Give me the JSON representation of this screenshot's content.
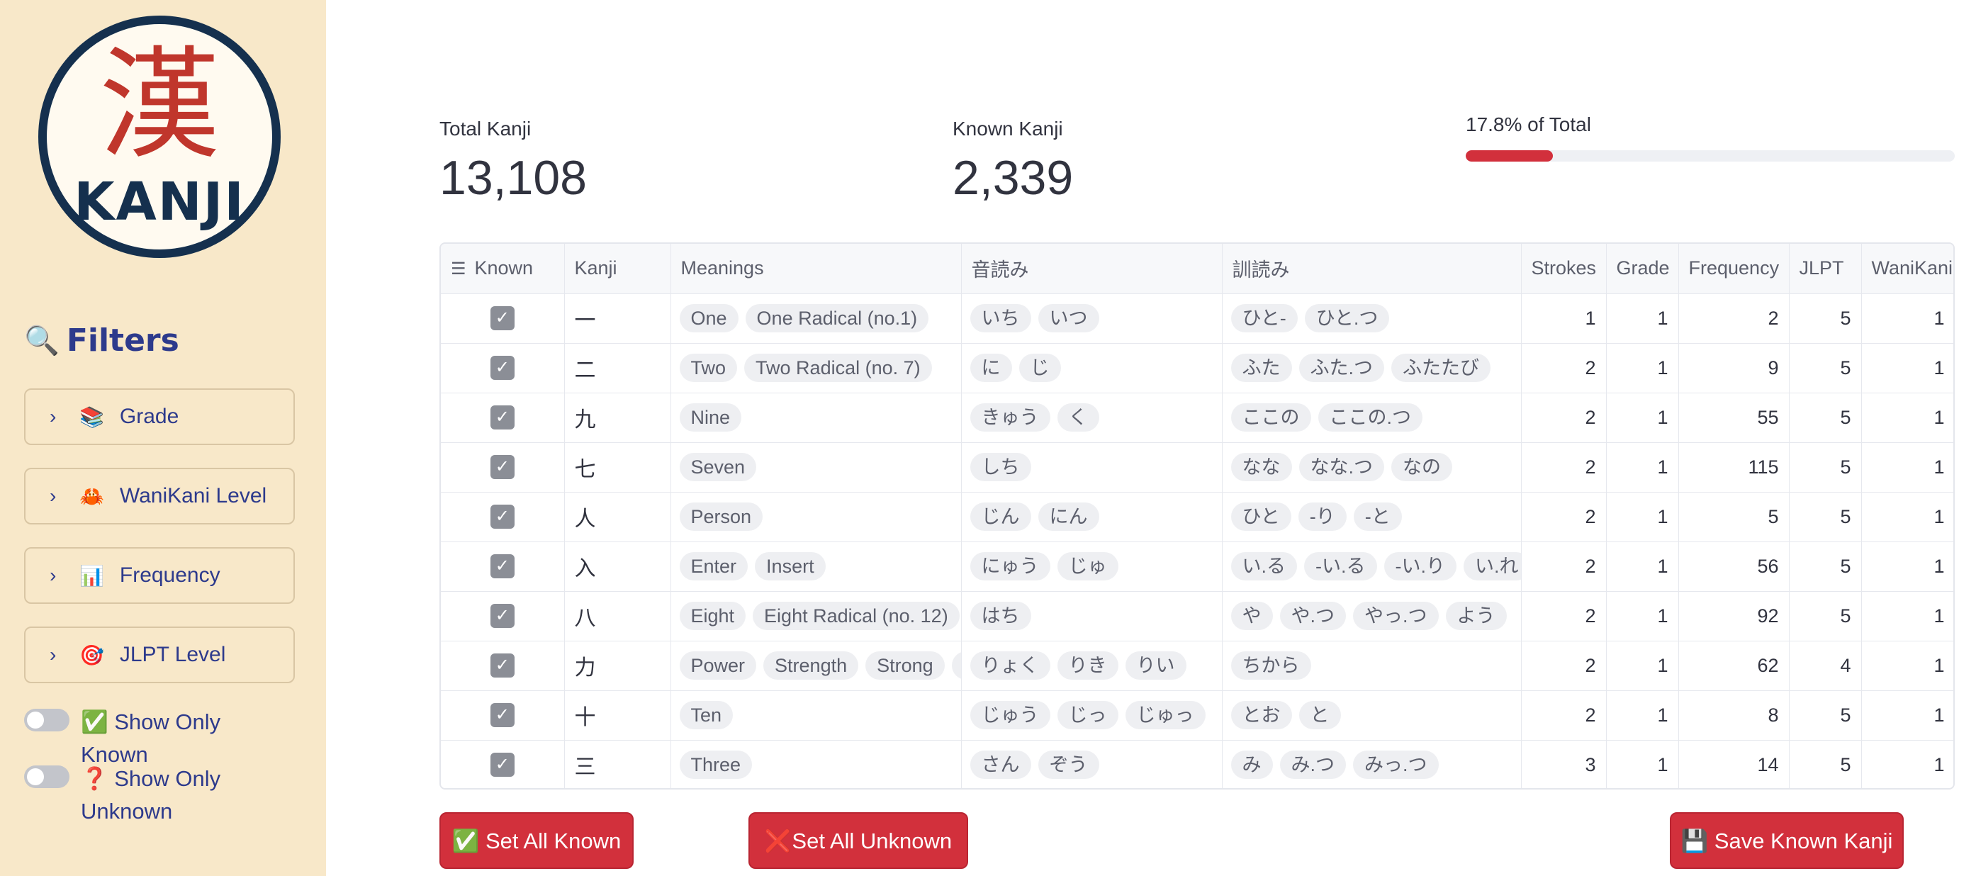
{
  "sidebar": {
    "logo": {
      "kanji": "漢",
      "word": "KANJI"
    },
    "filters_title": "Filters",
    "filters_icon": "magnifier-icon",
    "expanders": [
      {
        "icon": "📚",
        "label": "Grade"
      },
      {
        "icon": "🦀",
        "label": "WaniKani Level"
      },
      {
        "icon": "📊",
        "label": "Frequency"
      },
      {
        "icon": "🎯",
        "label": "JLPT Level"
      }
    ],
    "toggles": [
      {
        "label": "✅ Show Only Known",
        "on": false
      },
      {
        "label": "❓ Show Only Unknown",
        "on": false
      }
    ]
  },
  "metrics": {
    "total_label": "Total Kanji",
    "total_value": "13,108",
    "known_label": "Known Kanji",
    "known_value": "2,339",
    "progress_label": "17.8% of Total",
    "progress_fraction": 0.178
  },
  "table": {
    "columns": [
      "Known",
      "Kanji",
      "Meanings",
      "音読み",
      "訓読み",
      "Strokes",
      "Grade",
      "Frequency",
      "JLPT",
      "WaniKani"
    ],
    "rows": [
      {
        "known": true,
        "kanji": "一",
        "meanings": [
          "One",
          "One Radical (no.1)"
        ],
        "on": [
          "いち",
          "いつ"
        ],
        "kun": [
          "ひと-",
          "ひと.つ"
        ],
        "strokes": "1",
        "grade": "1",
        "frequency": "2",
        "jlpt": "5",
        "wanikani": "1"
      },
      {
        "known": true,
        "kanji": "二",
        "meanings": [
          "Two",
          "Two Radical (no. 7)"
        ],
        "on": [
          "に",
          "じ"
        ],
        "kun": [
          "ふた",
          "ふた.つ",
          "ふたたび"
        ],
        "strokes": "2",
        "grade": "1",
        "frequency": "9",
        "jlpt": "5",
        "wanikani": "1"
      },
      {
        "known": true,
        "kanji": "九",
        "meanings": [
          "Nine"
        ],
        "on": [
          "きゅう",
          "く"
        ],
        "kun": [
          "ここの",
          "ここの.つ"
        ],
        "strokes": "2",
        "grade": "1",
        "frequency": "55",
        "jlpt": "5",
        "wanikani": "1"
      },
      {
        "known": true,
        "kanji": "七",
        "meanings": [
          "Seven"
        ],
        "on": [
          "しち"
        ],
        "kun": [
          "なな",
          "なな.つ",
          "なの"
        ],
        "strokes": "2",
        "grade": "1",
        "frequency": "115",
        "jlpt": "5",
        "wanikani": "1"
      },
      {
        "known": true,
        "kanji": "人",
        "meanings": [
          "Person"
        ],
        "on": [
          "じん",
          "にん"
        ],
        "kun": [
          "ひと",
          "-り",
          "-と"
        ],
        "strokes": "2",
        "grade": "1",
        "frequency": "5",
        "jlpt": "5",
        "wanikani": "1"
      },
      {
        "known": true,
        "kanji": "入",
        "meanings": [
          "Enter",
          "Insert"
        ],
        "on": [
          "にゅう",
          "じゅ"
        ],
        "kun": [
          "い.る",
          "-い.る",
          "-い.り",
          "い.れ"
        ],
        "strokes": "2",
        "grade": "1",
        "frequency": "56",
        "jlpt": "5",
        "wanikani": "1"
      },
      {
        "known": true,
        "kanji": "八",
        "meanings": [
          "Eight",
          "Eight Radical (no. 12)"
        ],
        "on": [
          "はち"
        ],
        "kun": [
          "や",
          "や.つ",
          "やっ.つ",
          "よう"
        ],
        "strokes": "2",
        "grade": "1",
        "frequency": "92",
        "jlpt": "5",
        "wanikani": "1"
      },
      {
        "known": true,
        "kanji": "力",
        "meanings": [
          "Power",
          "Strength",
          "Strong",
          "S"
        ],
        "on": [
          "りょく",
          "りき",
          "りい"
        ],
        "kun": [
          "ちから"
        ],
        "strokes": "2",
        "grade": "1",
        "frequency": "62",
        "jlpt": "4",
        "wanikani": "1"
      },
      {
        "known": true,
        "kanji": "十",
        "meanings": [
          "Ten"
        ],
        "on": [
          "じゅう",
          "じっ",
          "じゅっ"
        ],
        "kun": [
          "とお",
          "と"
        ],
        "strokes": "2",
        "grade": "1",
        "frequency": "8",
        "jlpt": "5",
        "wanikani": "1"
      },
      {
        "known": true,
        "kanji": "三",
        "meanings": [
          "Three"
        ],
        "on": [
          "さん",
          "ぞう"
        ],
        "kun": [
          "み",
          "み.つ",
          "みっ.つ"
        ],
        "strokes": "3",
        "grade": "1",
        "frequency": "14",
        "jlpt": "5",
        "wanikani": "1"
      }
    ]
  },
  "buttons": {
    "set_all_known": "✅ Set All Known",
    "set_all_unknown": "❌Set All Unknown",
    "save": "💾 Save Known Kanji"
  },
  "colors": {
    "sidebar_bg": "#f8e8c9",
    "accent_red": "#d2303c",
    "navy": "#15304e",
    "filter_text": "#2d3a8c"
  }
}
